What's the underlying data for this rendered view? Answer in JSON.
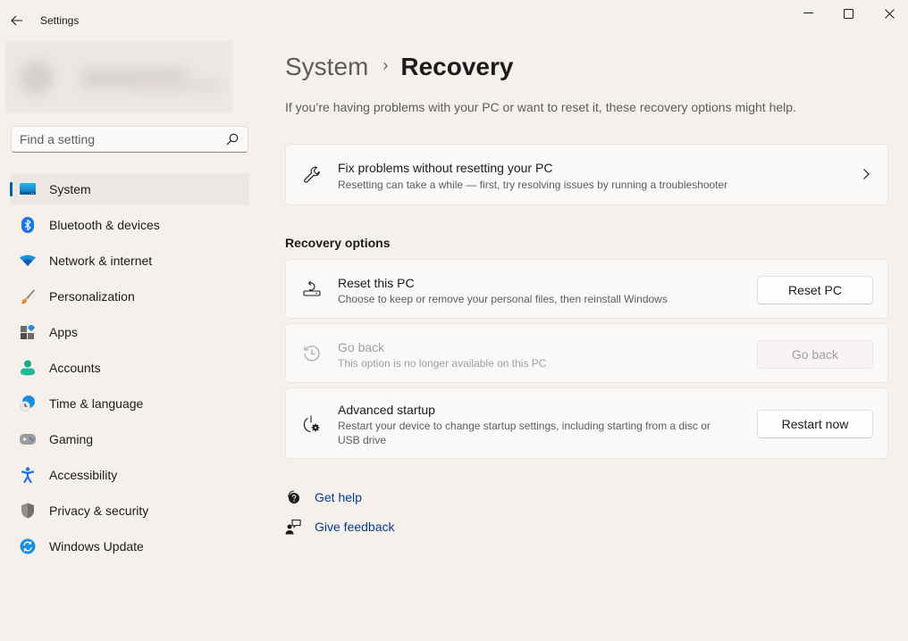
{
  "window": {
    "app_title": "Settings",
    "controls": {
      "minimize": "minimize",
      "maximize": "maximize",
      "close": "close"
    }
  },
  "search": {
    "placeholder": "Find a setting",
    "value": ""
  },
  "sidebar": {
    "accent_color": "#005fb8",
    "active_index": 0,
    "items": [
      {
        "label": "System",
        "icon": "system-icon"
      },
      {
        "label": "Bluetooth & devices",
        "icon": "bluetooth-icon"
      },
      {
        "label": "Network & internet",
        "icon": "wifi-icon"
      },
      {
        "label": "Personalization",
        "icon": "paintbrush-icon"
      },
      {
        "label": "Apps",
        "icon": "apps-icon"
      },
      {
        "label": "Accounts",
        "icon": "account-icon"
      },
      {
        "label": "Time & language",
        "icon": "clock-globe-icon"
      },
      {
        "label": "Gaming",
        "icon": "gamepad-icon"
      },
      {
        "label": "Accessibility",
        "icon": "accessibility-icon"
      },
      {
        "label": "Privacy & security",
        "icon": "shield-icon"
      },
      {
        "label": "Windows Update",
        "icon": "update-icon"
      }
    ]
  },
  "main": {
    "breadcrumb": {
      "parent": "System",
      "separator": "›",
      "current": "Recovery"
    },
    "intro": "If you’re having problems with your PC or want to reset it, these recovery options might help.",
    "fix_card": {
      "title": "Fix problems without resetting your PC",
      "description": "Resetting can take a while — first, try resolving issues by running a troubleshooter"
    },
    "section_label": "Recovery options",
    "options": [
      {
        "title": "Reset this PC",
        "description": "Choose to keep or remove your personal files, then reinstall Windows",
        "button": "Reset PC",
        "enabled": true
      },
      {
        "title": "Go back",
        "description": "This option is no longer available on this PC",
        "button": "Go back",
        "enabled": false
      },
      {
        "title": "Advanced startup",
        "description_line1": "Restart your device to change startup settings, including starting from a disc or",
        "description_line2": "USB drive",
        "button": "Restart now",
        "enabled": true
      }
    ],
    "links": [
      {
        "label": "Get help",
        "icon": "get-help-icon"
      },
      {
        "label": "Give feedback",
        "icon": "give-feedback-icon"
      }
    ],
    "link_color": "#003e92"
  }
}
